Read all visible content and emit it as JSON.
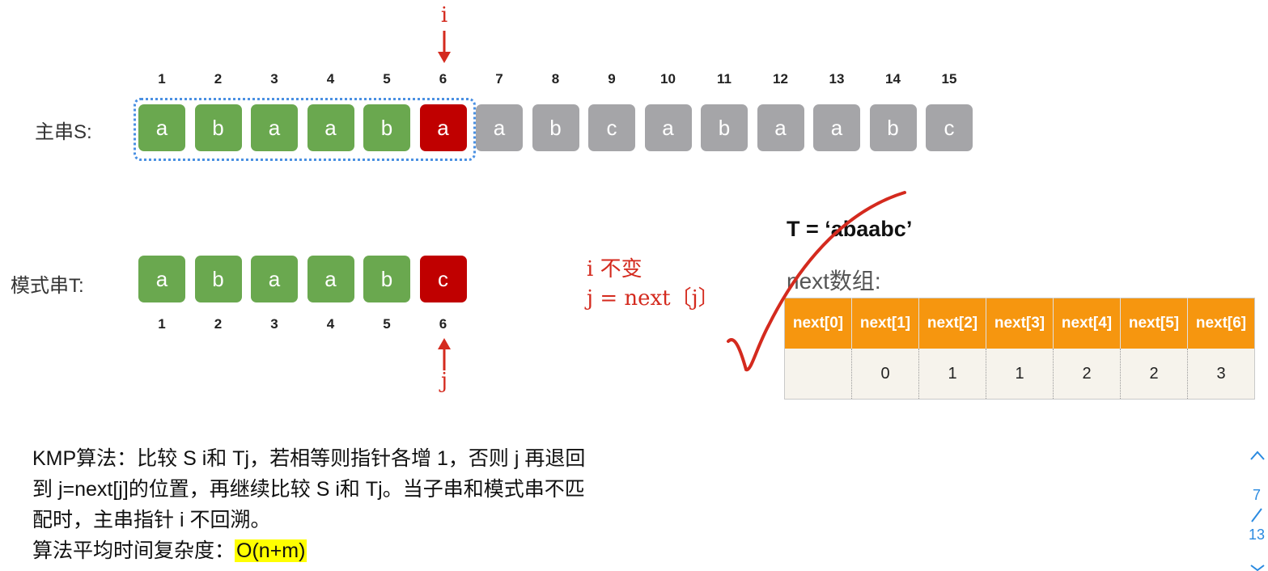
{
  "main_string": {
    "label": "主串S:",
    "indices": [
      "1",
      "2",
      "3",
      "4",
      "5",
      "6",
      "7",
      "8",
      "9",
      "10",
      "11",
      "12",
      "13",
      "14",
      "15"
    ],
    "chars": [
      {
        "ch": "a",
        "state": "matched"
      },
      {
        "ch": "b",
        "state": "matched"
      },
      {
        "ch": "a",
        "state": "matched"
      },
      {
        "ch": "a",
        "state": "matched"
      },
      {
        "ch": "b",
        "state": "matched"
      },
      {
        "ch": "a",
        "state": "mismatch"
      },
      {
        "ch": "a",
        "state": "pending"
      },
      {
        "ch": "b",
        "state": "pending"
      },
      {
        "ch": "c",
        "state": "pending"
      },
      {
        "ch": "a",
        "state": "pending"
      },
      {
        "ch": "b",
        "state": "pending"
      },
      {
        "ch": "a",
        "state": "pending"
      },
      {
        "ch": "a",
        "state": "pending"
      },
      {
        "ch": "b",
        "state": "pending"
      },
      {
        "ch": "c",
        "state": "pending"
      }
    ],
    "pointer_label": "i"
  },
  "pattern_string": {
    "label": "模式串T:",
    "indices": [
      "1",
      "2",
      "3",
      "4",
      "5",
      "6"
    ],
    "chars": [
      {
        "ch": "a",
        "state": "matched"
      },
      {
        "ch": "b",
        "state": "matched"
      },
      {
        "ch": "a",
        "state": "matched"
      },
      {
        "ch": "a",
        "state": "matched"
      },
      {
        "ch": "b",
        "state": "matched"
      },
      {
        "ch": "c",
        "state": "mismatch"
      }
    ],
    "pointer_label": "j"
  },
  "annotation": {
    "line1": "i 不变",
    "line2": "j = next〔j〕"
  },
  "next_table": {
    "title": "T = ‘abaabc’",
    "subtitle": "next数组:",
    "headers": [
      "next[0]",
      "next[1]",
      "next[2]",
      "next[3]",
      "next[4]",
      "next[5]",
      "next[6]"
    ],
    "values": [
      "",
      "0",
      "1",
      "1",
      "2",
      "2",
      "3"
    ]
  },
  "description": {
    "line1": "KMP算法：比较 S i和 Tj，若相等则指针各增 1，否则 j 再退回",
    "line2": "到 j=next[j]的位置，再继续比较 S i和 Tj。当子串和模式串不匹",
    "line3": "配时，主串指针 i 不回溯。",
    "line4_prefix": "算法平均时间复杂度：",
    "complexity": "O(n+m)"
  },
  "pager": {
    "current": "7",
    "total": "13"
  },
  "colors": {
    "matched": "#6aa84f",
    "mismatch": "#c00000",
    "pending": "#a5a5a8",
    "header": "#f6960f",
    "annotation": "#d42a1e",
    "highlight": "#ffff00"
  }
}
